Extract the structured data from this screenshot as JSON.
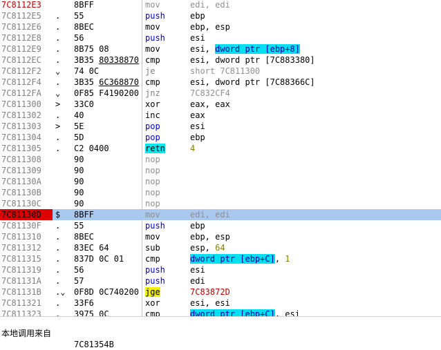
{
  "rows": [
    {
      "addr": "7C8112E3",
      "addr_style": "red",
      "mark": "",
      "hex": [
        {
          "t": "8BFF"
        }
      ],
      "mnem": "mov",
      "mnem_style": "gray",
      "ops": [
        {
          "t": "edi, edi",
          "c": "gray"
        }
      ]
    },
    {
      "addr": "7C8112E5",
      "mark": ".",
      "hex": [
        {
          "t": "55"
        }
      ],
      "mnem": "push",
      "mnem_style": "pp",
      "ops": [
        {
          "t": "ebp",
          "c": "blk"
        }
      ]
    },
    {
      "addr": "7C8112E6",
      "mark": ".",
      "hex": [
        {
          "t": "8BEC"
        }
      ],
      "mnem": "mov",
      "mnem_style": "blk",
      "ops": [
        {
          "t": "ebp, esp",
          "c": "blk"
        }
      ]
    },
    {
      "addr": "7C8112E8",
      "mark": ".",
      "hex": [
        {
          "t": "56"
        }
      ],
      "mnem": "push",
      "mnem_style": "pp",
      "ops": [
        {
          "t": "esi",
          "c": "blk"
        }
      ]
    },
    {
      "addr": "7C8112E9",
      "mark": ".",
      "hex": [
        {
          "t": "8B75 08"
        }
      ],
      "mnem": "mov",
      "mnem_style": "blk",
      "ops": [
        {
          "t": "esi, ",
          "c": "blk"
        },
        {
          "t": "dword ptr [ebp+8]",
          "c": "hl"
        }
      ]
    },
    {
      "addr": "7C8112EC",
      "mark": ".",
      "hex": [
        {
          "t": "3B35 "
        },
        {
          "t": "80338870",
          "u": true
        }
      ],
      "mnem": "cmp",
      "mnem_style": "blk",
      "ops": [
        {
          "t": "esi, dword ptr [7C883380]",
          "c": "blk"
        }
      ]
    },
    {
      "addr": "7C8112F2",
      "mark": "⌄",
      "hex": [
        {
          "t": "74 0C"
        }
      ],
      "mnem": "je",
      "mnem_style": "jmp",
      "ops": [
        {
          "t": "short 7C811300",
          "c": "gray"
        }
      ]
    },
    {
      "addr": "7C8112F4",
      "mark": ".",
      "hex": [
        {
          "t": "3B35 "
        },
        {
          "t": "6C368870",
          "u": true
        }
      ],
      "mnem": "cmp",
      "mnem_style": "blk",
      "ops": [
        {
          "t": "esi, dword ptr [7C88366C]",
          "c": "blk"
        }
      ]
    },
    {
      "addr": "7C8112FA",
      "mark": "⌄",
      "hex": [
        {
          "t": "0F85 F4190200"
        }
      ],
      "mnem": "jnz",
      "mnem_style": "jmp",
      "ops": [
        {
          "t": "7C832CF4",
          "c": "gray"
        }
      ]
    },
    {
      "addr": "7C811300",
      "mark": ">",
      "hex": [
        {
          "t": "33C0"
        }
      ],
      "mnem": "xor",
      "mnem_style": "blk",
      "ops": [
        {
          "t": "eax, eax",
          "c": "blk"
        }
      ]
    },
    {
      "addr": "7C811302",
      "mark": ".",
      "hex": [
        {
          "t": "40"
        }
      ],
      "mnem": "inc",
      "mnem_style": "blk",
      "ops": [
        {
          "t": "eax",
          "c": "blk"
        }
      ]
    },
    {
      "addr": "7C811303",
      "mark": ">",
      "hex": [
        {
          "t": "5E"
        }
      ],
      "mnem": "pop",
      "mnem_style": "pp",
      "ops": [
        {
          "t": "esi",
          "c": "blk"
        }
      ]
    },
    {
      "addr": "7C811304",
      "mark": ".",
      "hex": [
        {
          "t": "5D"
        }
      ],
      "mnem": "pop",
      "mnem_style": "pp",
      "ops": [
        {
          "t": "ebp",
          "c": "blk"
        }
      ]
    },
    {
      "addr": "7C811305",
      "mark": ".",
      "hex": [
        {
          "t": "C2 0400"
        }
      ],
      "mnem": "retn",
      "mnem_style": "ret",
      "ops": [
        {
          "t": "4",
          "c": "num"
        }
      ]
    },
    {
      "addr": "7C811308",
      "mark": "",
      "hex": [
        {
          "t": "90"
        }
      ],
      "mnem": "nop",
      "mnem_style": "gray",
      "ops": []
    },
    {
      "addr": "7C811309",
      "mark": "",
      "hex": [
        {
          "t": "90"
        }
      ],
      "mnem": "nop",
      "mnem_style": "gray",
      "ops": []
    },
    {
      "addr": "7C81130A",
      "mark": "",
      "hex": [
        {
          "t": "90"
        }
      ],
      "mnem": "nop",
      "mnem_style": "gray",
      "ops": []
    },
    {
      "addr": "7C81130B",
      "mark": "",
      "hex": [
        {
          "t": "90"
        }
      ],
      "mnem": "nop",
      "mnem_style": "gray",
      "ops": []
    },
    {
      "addr": "7C81130C",
      "mark": "",
      "hex": [
        {
          "t": "90"
        }
      ],
      "mnem": "nop",
      "mnem_style": "gray",
      "ops": []
    },
    {
      "addr": "7C81130D",
      "addr_style": "redbg",
      "selected": true,
      "mark": "$",
      "hex": [
        {
          "t": "8BFF"
        }
      ],
      "mnem": "mov",
      "mnem_style": "gray",
      "ops": [
        {
          "t": "edi, edi",
          "c": "gray"
        }
      ]
    },
    {
      "addr": "7C81130F",
      "mark": ".",
      "hex": [
        {
          "t": "55"
        }
      ],
      "mnem": "push",
      "mnem_style": "pp",
      "ops": [
        {
          "t": "ebp",
          "c": "blk"
        }
      ]
    },
    {
      "addr": "7C811310",
      "mark": ".",
      "hex": [
        {
          "t": "8BEC"
        }
      ],
      "mnem": "mov",
      "mnem_style": "blk",
      "ops": [
        {
          "t": "ebp, esp",
          "c": "blk"
        }
      ]
    },
    {
      "addr": "7C811312",
      "mark": ".",
      "hex": [
        {
          "t": "83EC 64"
        }
      ],
      "mnem": "sub",
      "mnem_style": "blk",
      "ops": [
        {
          "t": "esp, ",
          "c": "blk"
        },
        {
          "t": "64",
          "c": "num"
        }
      ]
    },
    {
      "addr": "7C811315",
      "mark": ".",
      "hex": [
        {
          "t": "837D 0C 01"
        }
      ],
      "mnem": "cmp",
      "mnem_style": "blk",
      "ops": [
        {
          "t": "dword ptr [ebp+C]",
          "c": "hl"
        },
        {
          "t": ", ",
          "c": "blk"
        },
        {
          "t": "1",
          "c": "num"
        }
      ]
    },
    {
      "addr": "7C811319",
      "mark": ".",
      "hex": [
        {
          "t": "56"
        }
      ],
      "mnem": "push",
      "mnem_style": "pp",
      "ops": [
        {
          "t": "esi",
          "c": "blk"
        }
      ]
    },
    {
      "addr": "7C81131A",
      "mark": ".",
      "hex": [
        {
          "t": "57"
        }
      ],
      "mnem": "push",
      "mnem_style": "pp",
      "ops": [
        {
          "t": "edi",
          "c": "blk"
        }
      ]
    },
    {
      "addr": "7C81131B",
      "mark": ".⌄",
      "hex": [
        {
          "t": "0F8D 0C740200"
        }
      ],
      "mnem": "jge",
      "mnem_style": "jge",
      "ops": [
        {
          "t": "7C83872D",
          "c": "red"
        }
      ]
    },
    {
      "addr": "7C811321",
      "mark": ".",
      "hex": [
        {
          "t": "33F6"
        }
      ],
      "mnem": "xor",
      "mnem_style": "blk",
      "ops": [
        {
          "t": "esi, esi",
          "c": "blk"
        }
      ]
    },
    {
      "addr": "7C811323",
      "mark": ".",
      "hex": [
        {
          "t": "3975 0C"
        }
      ],
      "mnem": "cmp",
      "mnem_style": "blk",
      "ops": [
        {
          "t": "dword ptr [ebp+C]",
          "c": "hl"
        },
        {
          "t": ", esi",
          "c": "blk"
        }
      ]
    }
  ],
  "status": {
    "label": "本地调用来自",
    "value": "7C81354B"
  }
}
